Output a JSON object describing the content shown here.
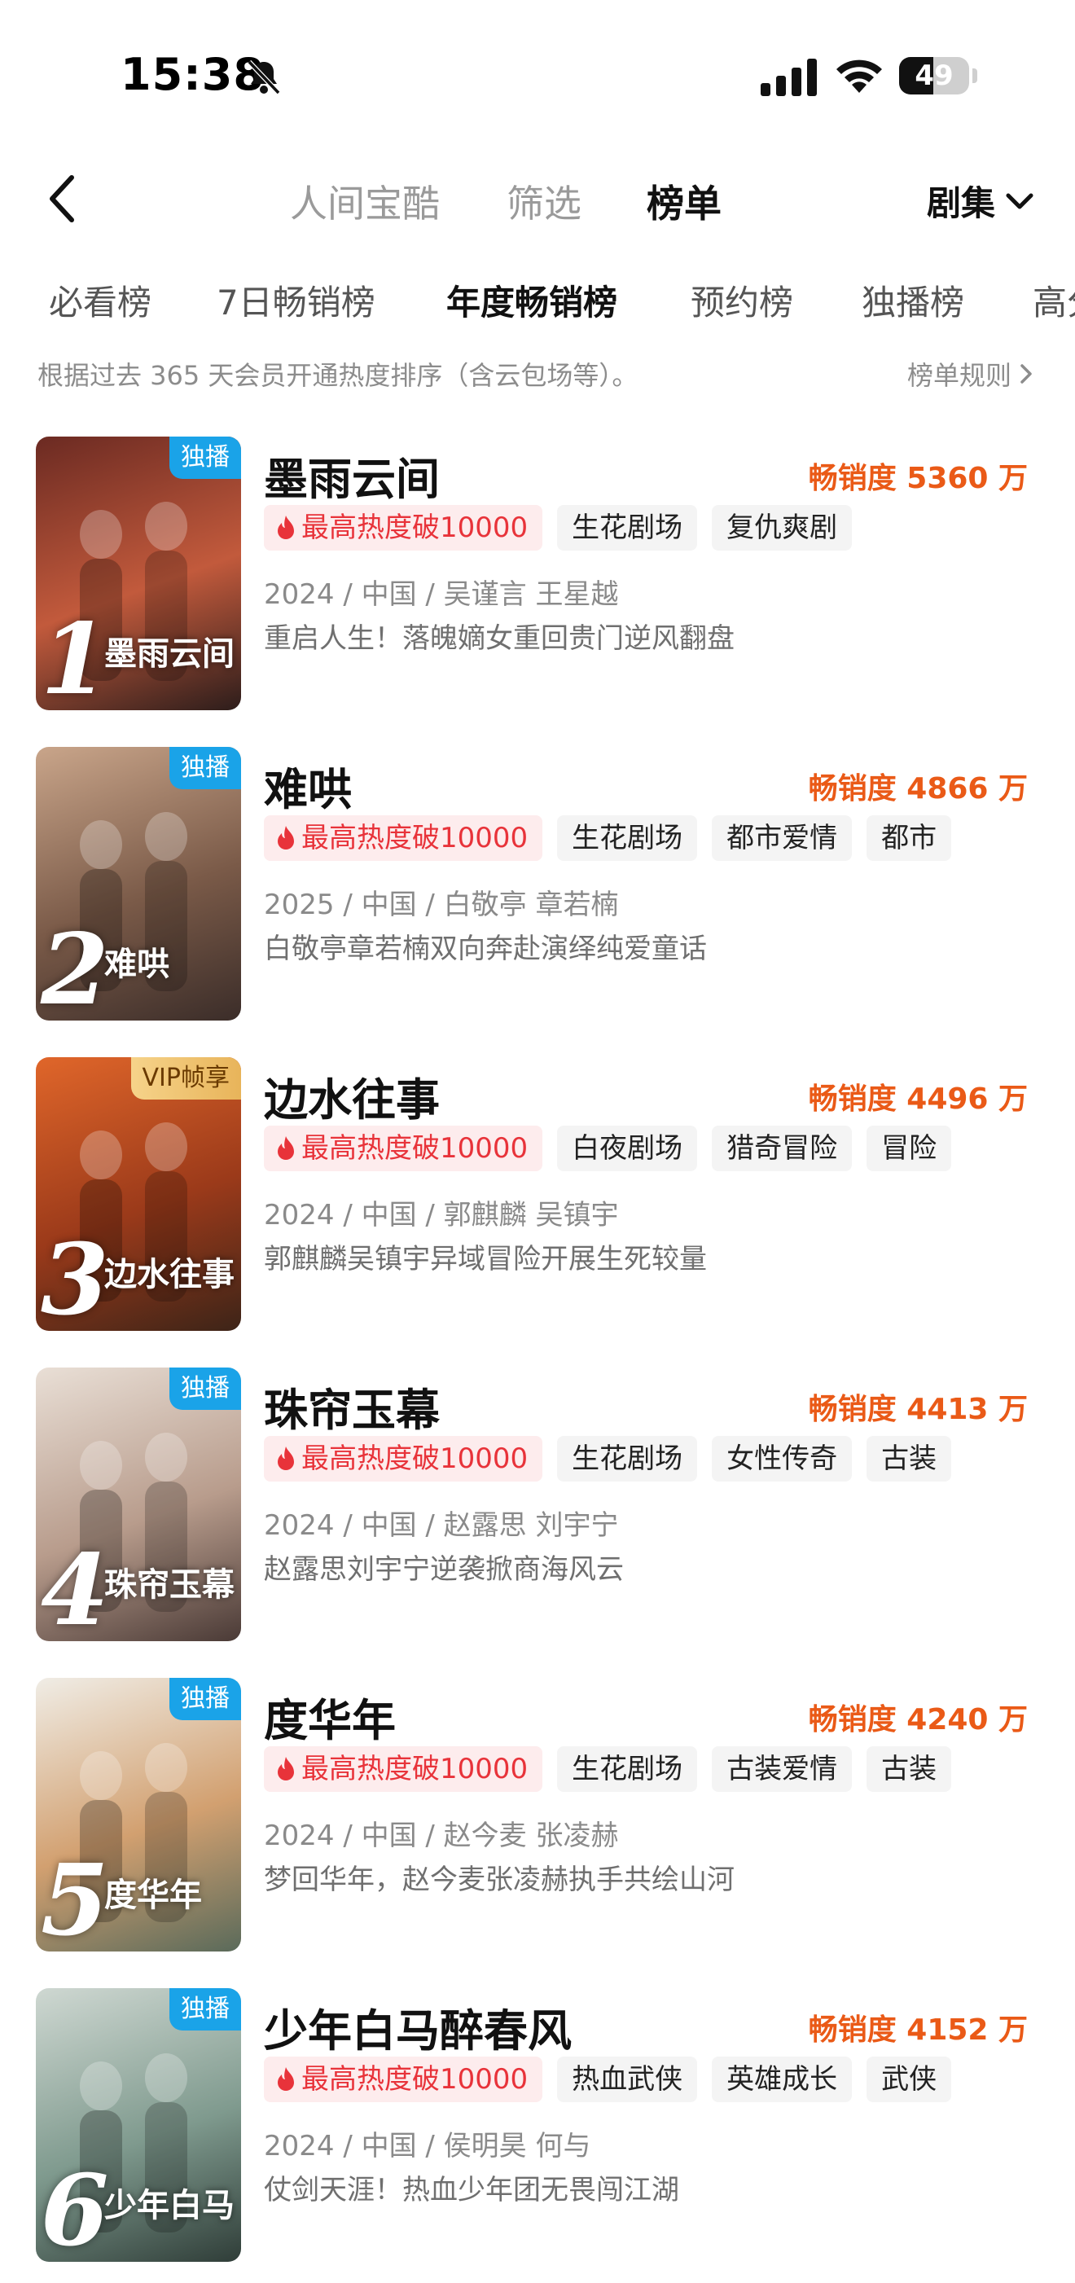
{
  "status_bar": {
    "time": "15:38",
    "battery": "49",
    "battery_level": 0.49
  },
  "nav": {
    "tabs": [
      {
        "label": "人间宝酷",
        "active": false
      },
      {
        "label": "筛选",
        "active": false
      },
      {
        "label": "榜单",
        "active": true
      }
    ],
    "dropdown_label": "剧集"
  },
  "subtabs": [
    {
      "label": "必看榜",
      "active": false
    },
    {
      "label": "7日畅销榜",
      "active": false
    },
    {
      "label": "年度畅销榜",
      "active": true
    },
    {
      "label": "预约榜",
      "active": false
    },
    {
      "label": "独播榜",
      "active": false
    },
    {
      "label": "高分",
      "active": false
    }
  ],
  "description": "根据过去 365 天会员开通热度排序（含云包场等）。",
  "rules_label": "榜单规则",
  "colors": {
    "accent": "#ea5a17",
    "hot": "#e8333a",
    "badge_blue": "#1aa3e8"
  },
  "items": [
    {
      "rank": "1",
      "badge": "独播",
      "badge_type": "blue",
      "poster_title": "墨雨云间",
      "title": "墨雨云间",
      "sales": "畅销度 5360 万",
      "tags": [
        "最高热度破10000",
        "生花剧场",
        "复仇爽剧"
      ],
      "meta": "2024 / 中国 / 吴谨言 王星越",
      "synopsis": "重启人生！落魄嫡女重回贵门逆风翻盘",
      "poster_colors": [
        "#6b2a22",
        "#c25a3c",
        "#2d1d1b"
      ]
    },
    {
      "rank": "2",
      "badge": "独播",
      "badge_type": "blue",
      "poster_title": "难哄",
      "title": "难哄",
      "sales": "畅销度 4866 万",
      "tags": [
        "最高热度破10000",
        "生花剧场",
        "都市爱情",
        "都市"
      ],
      "meta": "2025 / 中国 / 白敬亭 章若楠",
      "synopsis": "白敬亭章若楠双向奔赴演绎纯爱童话",
      "poster_colors": [
        "#c9a58a",
        "#7a5a48",
        "#3b2d29"
      ]
    },
    {
      "rank": "3",
      "badge": "VIP帧享",
      "badge_type": "gold",
      "poster_title": "边水往事",
      "title": "边水往事",
      "sales": "畅销度 4496 万",
      "tags": [
        "最高热度破10000",
        "白夜剧场",
        "猎奇冒险",
        "冒险"
      ],
      "meta": "2024 / 中国 / 郭麒麟 吴镇宇",
      "synopsis": "郭麒麟吴镇宇异域冒险开展生死较量",
      "poster_colors": [
        "#e0662a",
        "#9b3a1a",
        "#3d2418"
      ]
    },
    {
      "rank": "4",
      "badge": "独播",
      "badge_type": "blue",
      "poster_title": "珠帘玉幕",
      "title": "珠帘玉幕",
      "sales": "畅销度 4413 万",
      "tags": [
        "最高热度破10000",
        "生花剧场",
        "女性传奇",
        "古装"
      ],
      "meta": "2024 / 中国 / 赵露思 刘宇宁",
      "synopsis": "赵露思刘宇宁逆袭掀商海风云",
      "poster_colors": [
        "#e9dfd6",
        "#b89c8c",
        "#4a3a36"
      ]
    },
    {
      "rank": "5",
      "badge": "独播",
      "badge_type": "blue",
      "poster_title": "度华年",
      "title": "度华年",
      "sales": "畅销度 4240 万",
      "tags": [
        "最高热度破10000",
        "生花剧场",
        "古装爱情",
        "古装"
      ],
      "meta": "2024 / 中国 / 赵今麦 张凌赫",
      "synopsis": "梦回华年，赵今麦张凌赫执手共绘山河",
      "poster_colors": [
        "#f0ede6",
        "#d2a070",
        "#5a6a5a"
      ]
    },
    {
      "rank": "6",
      "badge": "独播",
      "badge_type": "blue",
      "poster_title": "少年白马",
      "title": "少年白马醉春风",
      "sales": "畅销度 4152 万",
      "tags": [
        "最高热度破10000",
        "热血武侠",
        "英雄成长",
        "武侠"
      ],
      "meta": "2024 / 中国 / 侯明昊 何与",
      "synopsis": "仗剑天涯！热血少年团无畏闯江湖",
      "poster_colors": [
        "#cfd8d2",
        "#7f9a8e",
        "#2f3d38"
      ]
    }
  ]
}
